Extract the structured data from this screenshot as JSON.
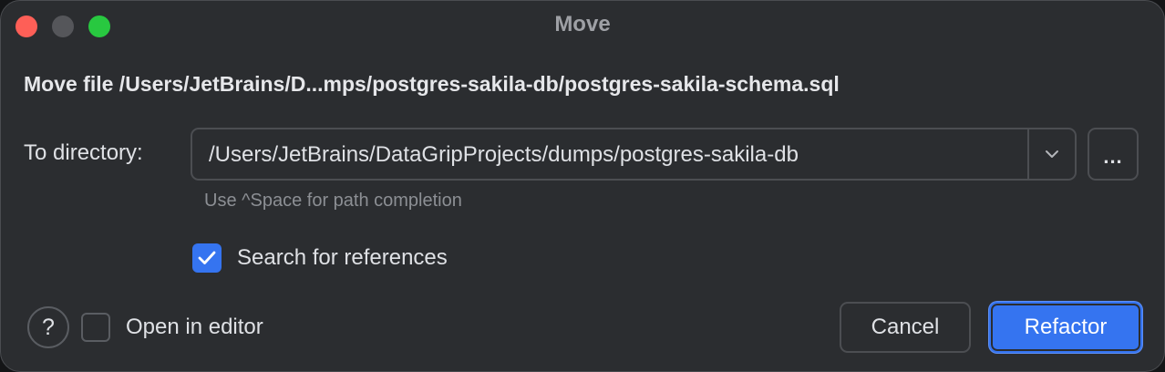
{
  "window": {
    "title": "Move"
  },
  "dialog": {
    "heading": "Move file /Users/JetBrains/D...mps/postgres-sakila-db/postgres-sakila-schema.sql",
    "directory_label": "To directory:",
    "directory_value": "/Users/JetBrains/DataGripProjects/dumps/postgres-sakila-db",
    "browse_label": "...",
    "hint": "Use ^Space for path completion",
    "search_references": {
      "label": "Search for references",
      "checked": true
    },
    "open_in_editor": {
      "label": "Open in editor",
      "checked": false
    },
    "help_label": "?",
    "cancel_label": "Cancel",
    "refactor_label": "Refactor"
  },
  "colors": {
    "accent": "#3574f0",
    "background": "#2b2d30",
    "close": "#fe5f57",
    "zoom": "#28c840"
  },
  "icons": {
    "dropdown": "chevron-down-icon",
    "checked": "checkmark-icon"
  }
}
